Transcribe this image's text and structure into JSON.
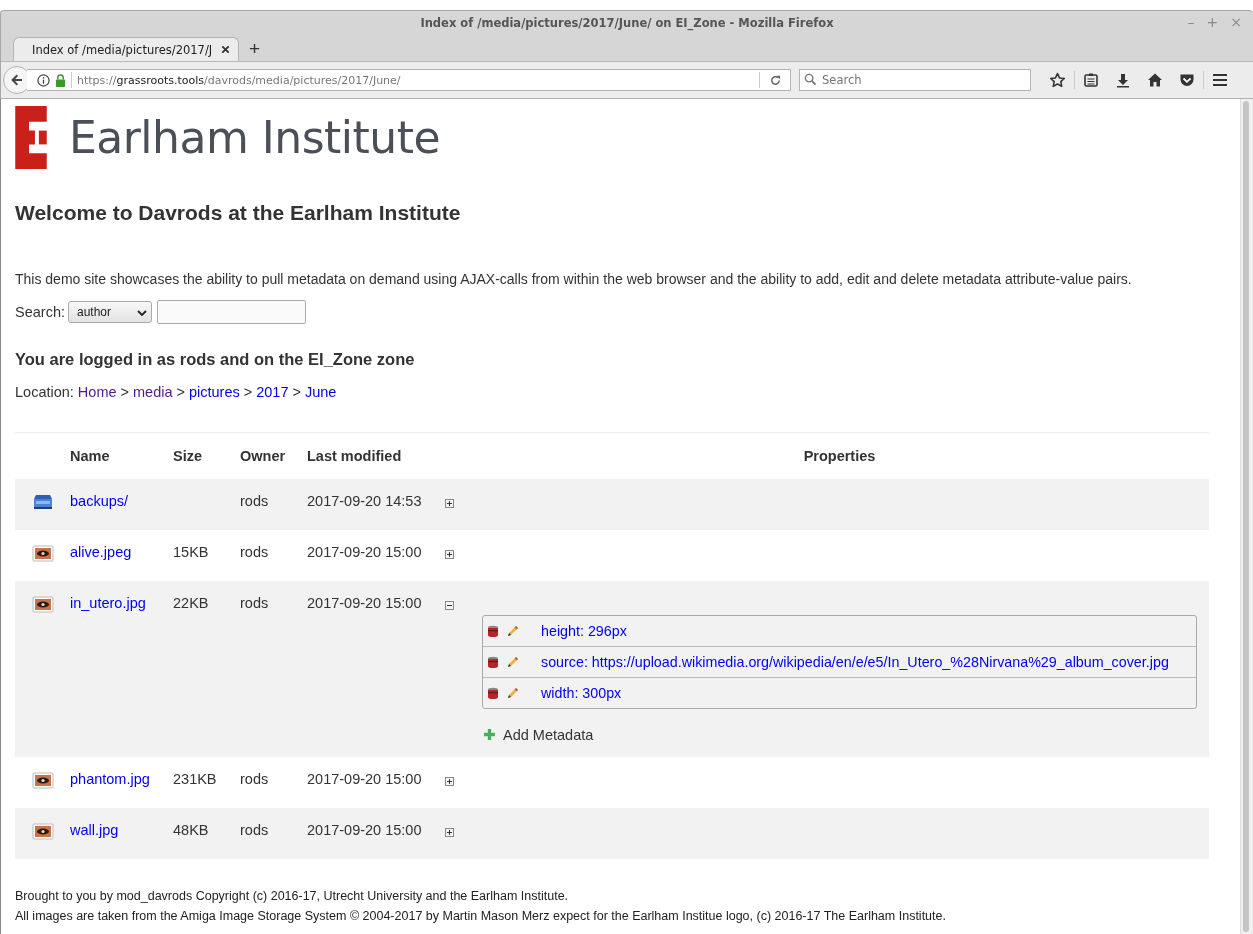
{
  "window": {
    "title": "Index of /media/pictures/2017/June/ on EI_Zone - Mozilla Firefox",
    "controls": [
      "–",
      "+",
      "×"
    ]
  },
  "tabs": [
    {
      "label": "Index of /media/pictures/2017/J",
      "selected": true
    }
  ],
  "new_tab": "+",
  "address_bar": {
    "scheme": "https://",
    "host": "grassroots.tools",
    "path": "/davrods/media/pictures/2017/June/"
  },
  "search_field": {
    "placeholder": "Search"
  },
  "logo": {
    "text": "Earlham Institute"
  },
  "heading": "Welcome to Davrods at the Earlham Institute",
  "intro": "This demo site showcases the ability to pull metadata on demand using AJAX-calls from within the web browser and the ability to add, edit and delete metadata attribute-value pairs.",
  "search": {
    "label": "Search:",
    "select_value": "author"
  },
  "login_heading": "You are logged in as rods and on the EI_Zone zone",
  "location": {
    "label": "Location:",
    "crumbs": [
      {
        "text": "Home",
        "visited": true
      },
      {
        "text": "media",
        "visited": true
      },
      {
        "text": "pictures",
        "visited": false
      },
      {
        "text": "2017",
        "visited": false
      },
      {
        "text": "June",
        "visited": false
      }
    ],
    "separator": ">"
  },
  "table": {
    "columns": [
      "Name",
      "Size",
      "Owner",
      "Last modified",
      "Properties"
    ],
    "rows": [
      {
        "kind": "folder",
        "name": "backups/",
        "owner": "rods",
        "modified": "2017-09-20 14:53",
        "expanded": false
      },
      {
        "kind": "image",
        "name": "alive.jpeg",
        "size": "15KB",
        "owner": "rods",
        "modified": "2017-09-20 15:00",
        "expanded": false
      },
      {
        "kind": "image",
        "name": "in_utero.jpg",
        "size": "22KB",
        "owner": "rods",
        "modified": "2017-09-20 15:00",
        "expanded": true,
        "metadata": [
          "height: 296px",
          "source: https://upload.wikimedia.org/wikipedia/en/e/e5/In_Utero_%28Nirvana%29_album_cover.jpg",
          "width: 300px"
        ],
        "add_metadata": "Add Metadata"
      },
      {
        "kind": "image",
        "name": "phantom.jpg",
        "size": "231KB",
        "owner": "rods",
        "modified": "2017-09-20 15:00",
        "expanded": false
      },
      {
        "kind": "image",
        "name": "wall.jpg",
        "size": "48KB",
        "owner": "rods",
        "modified": "2017-09-20 15:00",
        "expanded": false
      }
    ]
  },
  "footer": [
    "Brought to you by mod_davrods Copyright (c) 2016-17, Utrecht University and the Earlham Institute.",
    "All images are taken from the Amiga Image Storage System © 2004-2017 by Martin Mason Merz expect for the Earlham Institue logo, (c) 2016-17 The Earlham Institute."
  ]
}
